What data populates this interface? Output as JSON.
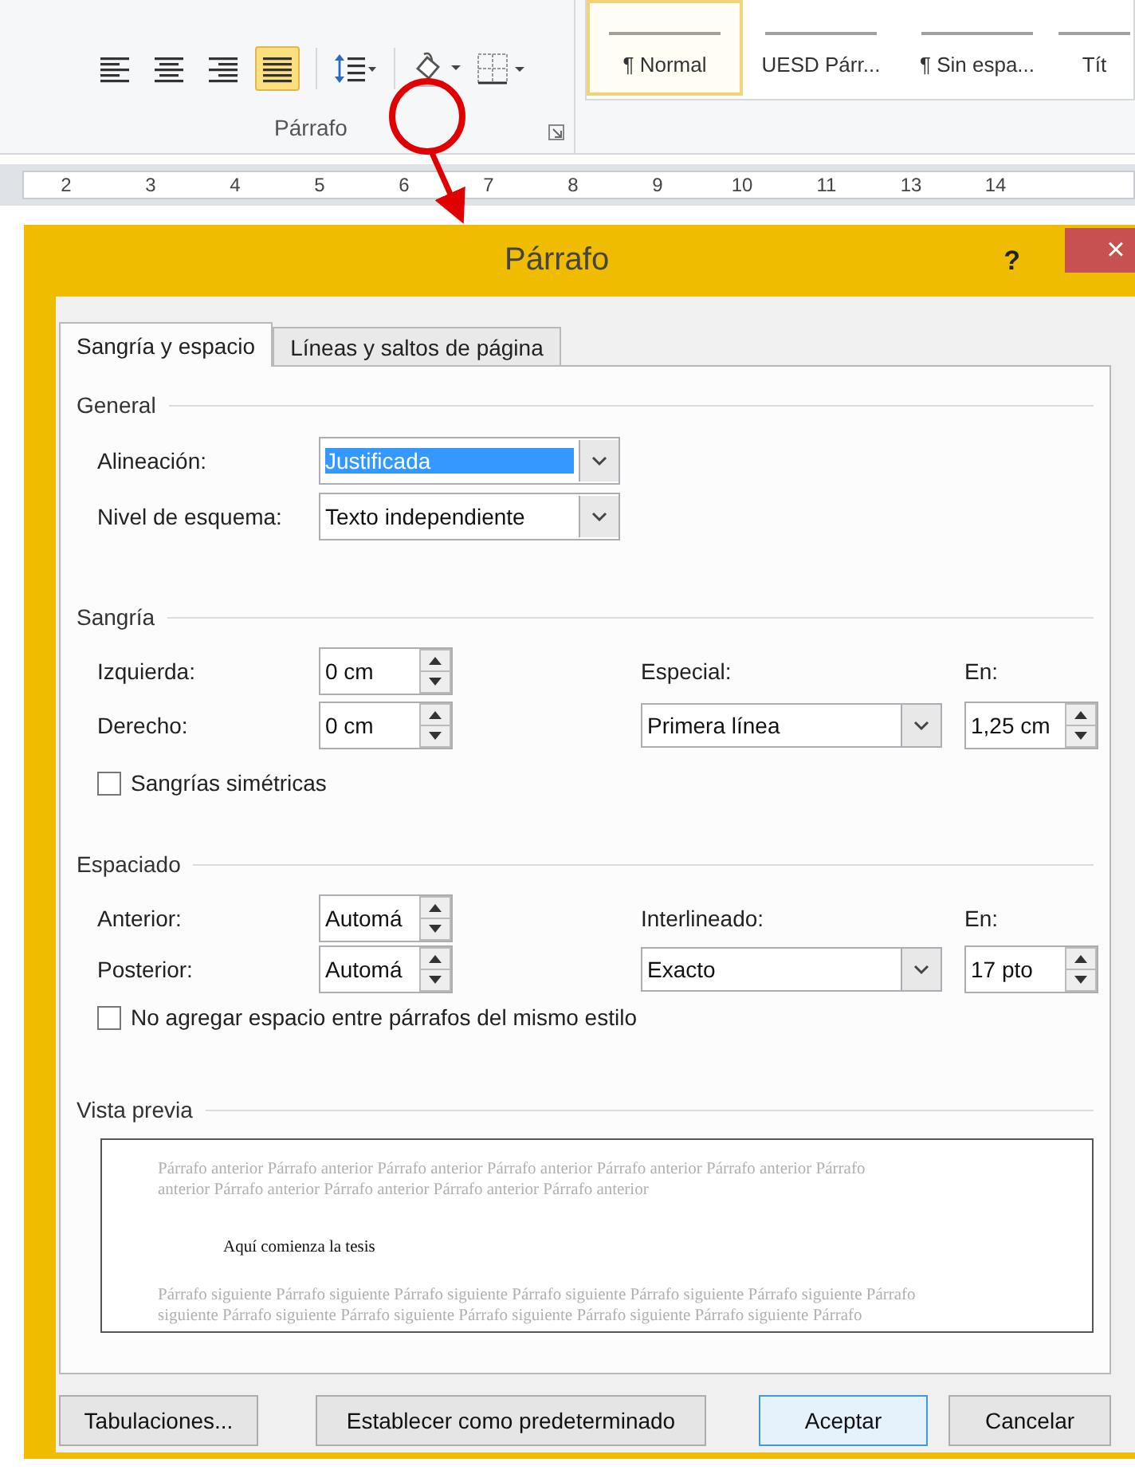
{
  "ribbon": {
    "paragraph_group": {
      "label": "Párrafo",
      "align_buttons": [
        {
          "kind": "left",
          "selected": false
        },
        {
          "kind": "center",
          "selected": false
        },
        {
          "kind": "right",
          "selected": false
        },
        {
          "kind": "justify",
          "selected": true
        }
      ]
    },
    "styles": [
      {
        "label": "¶ Normal",
        "selected": true
      },
      {
        "label": "UESD Párr...",
        "selected": false
      },
      {
        "label": "¶ Sin espa...",
        "selected": false
      },
      {
        "label": "Tít",
        "selected": false
      }
    ]
  },
  "ruler": {
    "numbers": [
      "2",
      "3",
      "4",
      "5",
      "6",
      "7",
      "8",
      "9",
      "10",
      "11",
      "13",
      "14"
    ]
  },
  "dialog": {
    "title": "Párrafo",
    "help": "?",
    "close": "×",
    "tabs": [
      {
        "label": "Sangría y espacio",
        "selected": true
      },
      {
        "label": "Líneas y saltos de página",
        "selected": false
      }
    ],
    "general": {
      "heading": "General",
      "alignment": {
        "label": "Alineación:",
        "value": "Justificada",
        "highlighted": true
      },
      "outline_level": {
        "label": "Nivel de esquema:",
        "value": "Texto independiente",
        "highlighted": false
      }
    },
    "indentation": {
      "heading": "Sangría",
      "left": {
        "label": "Izquierda:",
        "value": "0 cm"
      },
      "right": {
        "label": "Derecho:",
        "value": "0 cm"
      },
      "special": {
        "label": "Especial:",
        "value": "Primera línea"
      },
      "by": {
        "label": "En:",
        "value": "1,25 cm"
      },
      "mirror": {
        "label": "Sangrías simétricas",
        "checked": false
      }
    },
    "spacing": {
      "heading": "Espaciado",
      "before": {
        "label": "Anterior:",
        "value": "Automá"
      },
      "after": {
        "label": "Posterior:",
        "value": "Automá"
      },
      "line_spacing": {
        "label": "Interlineado:",
        "value": "Exacto"
      },
      "at": {
        "label": "En:",
        "value": "17 pto"
      },
      "no_space": {
        "label": "No agregar espacio entre párrafos del mismo estilo",
        "checked": false
      }
    },
    "preview": {
      "heading": "Vista previa",
      "previous_lines": [
        "Párrafo anterior Párrafo anterior Párrafo anterior Párrafo anterior Párrafo anterior Párrafo anterior Párrafo",
        "anterior Párrafo anterior Párrafo anterior Párrafo anterior Párrafo anterior"
      ],
      "current": "Aquí comienza la tesis",
      "next_lines": [
        "Párrafo siguiente Párrafo siguiente Párrafo siguiente Párrafo siguiente Párrafo siguiente Párrafo siguiente Párrafo",
        "siguiente Párrafo siguiente Párrafo siguiente Párrafo siguiente Párrafo siguiente Párrafo siguiente Párrafo"
      ]
    },
    "buttons": [
      {
        "label": "Tabulaciones...",
        "kind": "tabs",
        "default": false
      },
      {
        "label": "Establecer como predeterminado",
        "kind": "set_default",
        "default": false
      },
      {
        "label": "Aceptar",
        "kind": "ok",
        "default": true
      },
      {
        "label": "Cancelar",
        "kind": "cancel",
        "default": false
      }
    ]
  }
}
